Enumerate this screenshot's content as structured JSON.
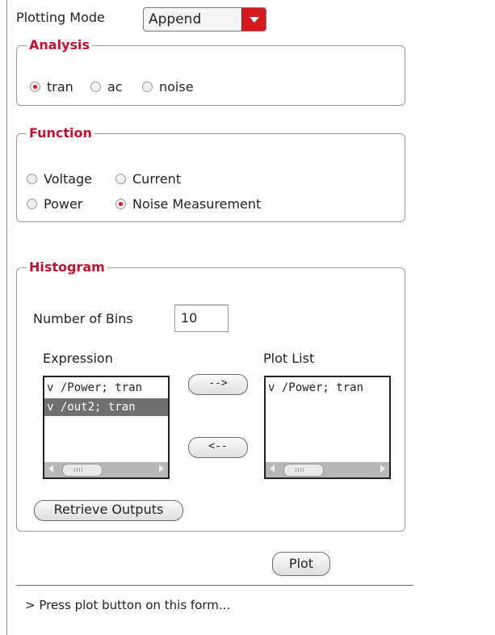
{
  "plotting_mode": {
    "label": "Plotting Mode",
    "value": "Append"
  },
  "analysis": {
    "title": "Analysis",
    "options": [
      {
        "label": "tran",
        "selected": true
      },
      {
        "label": "ac",
        "selected": false
      },
      {
        "label": "noise",
        "selected": false
      }
    ]
  },
  "function": {
    "title": "Function",
    "options": [
      {
        "label": "Voltage",
        "selected": false
      },
      {
        "label": "Current",
        "selected": false
      },
      {
        "label": "Power",
        "selected": false
      },
      {
        "label": "Noise Measurement",
        "selected": true
      }
    ]
  },
  "histogram": {
    "title": "Histogram",
    "bins_label": "Number of Bins",
    "bins_value": "10",
    "expression_label": "Expression",
    "plot_list_label": "Plot List",
    "expression_items": [
      "v /Power; tran",
      "v /out2; tran"
    ],
    "plot_list_items": [
      "v /Power; tran"
    ],
    "add_label": "-->",
    "remove_label": "<--",
    "retrieve_label": "Retrieve Outputs"
  },
  "plot_button": "Plot",
  "status_text": "> Press plot button on this form...",
  "colors": {
    "accent": "#d71920",
    "title": "#c8102e",
    "selection": "#6f6f6f"
  }
}
